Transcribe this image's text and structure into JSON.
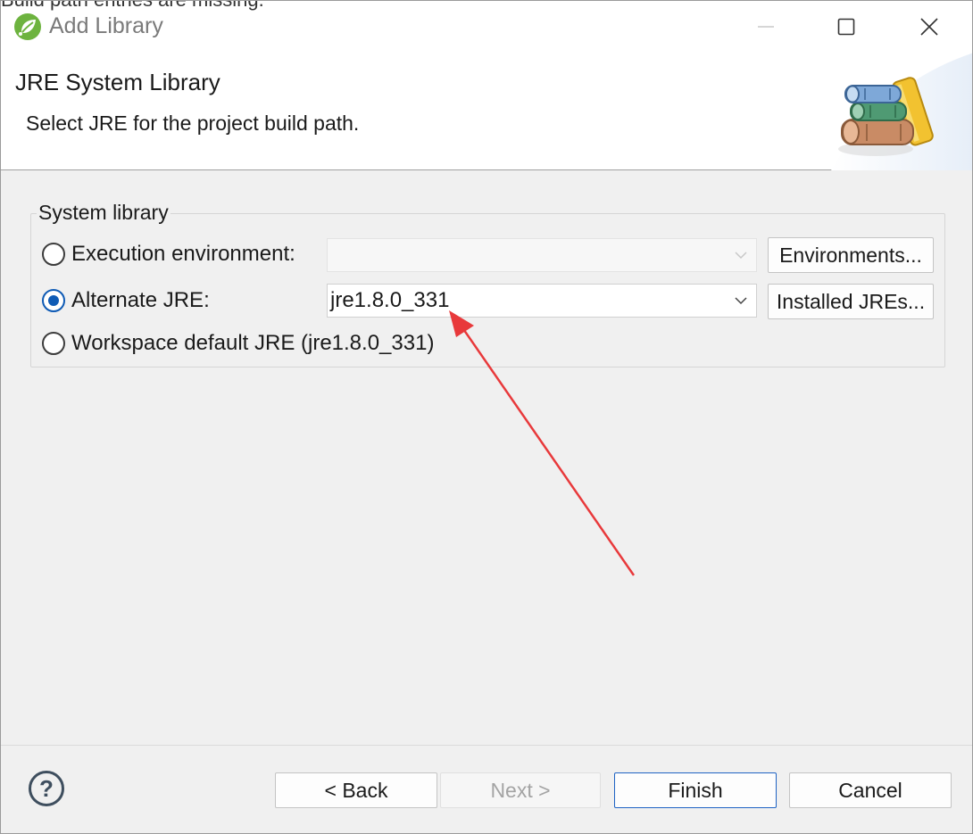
{
  "background_text": "Build path entries are missing.",
  "window": {
    "title": "Add Library",
    "controls": {
      "minimize": "minimize-icon",
      "maximize": "maximize-icon",
      "close": "close-icon"
    }
  },
  "header": {
    "title": "JRE System Library",
    "description": "Select JRE for the project build path.",
    "art_icon": "books-icon"
  },
  "system_library": {
    "group_label": "System library",
    "options": [
      {
        "label": "Execution environment:",
        "checked": false
      },
      {
        "label": "Alternate JRE:",
        "checked": true
      },
      {
        "label": "Workspace default JRE (jre1.8.0_331)",
        "checked": false
      }
    ],
    "execution_environment_value": "",
    "alternate_jre_value": "jre1.8.0_331",
    "environments_button": "Environments...",
    "installed_jres_button": "Installed JREs..."
  },
  "footer": {
    "help_label": "?",
    "back": "< Back",
    "next": "Next >",
    "finish": "Finish",
    "cancel": "Cancel"
  },
  "annotation": {
    "color": "#e8393b",
    "points_to": "alternate-jre-combo"
  },
  "colors": {
    "accent": "#0f5bb5",
    "title_text": "#7a7a7a"
  }
}
